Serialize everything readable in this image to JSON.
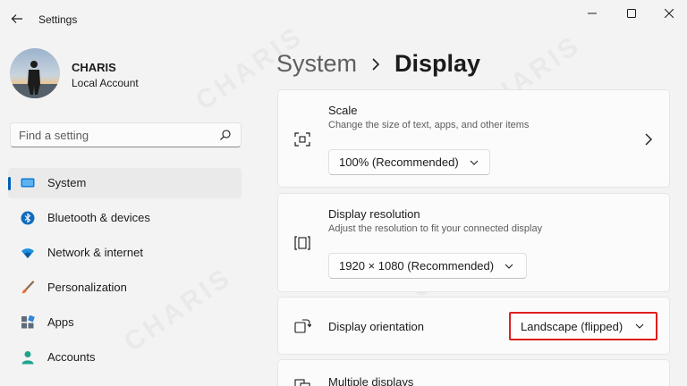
{
  "window": {
    "title": "Settings",
    "icons": {
      "back": "back-arrow-icon",
      "minimize": "minimize-icon",
      "maximize": "maximize-icon",
      "close": "close-icon"
    }
  },
  "profile": {
    "name": "CHARIS",
    "account_type": "Local Account"
  },
  "search": {
    "placeholder": "Find a setting"
  },
  "nav": {
    "items": [
      {
        "label": "System",
        "icon": "system-icon",
        "active": true
      },
      {
        "label": "Bluetooth & devices",
        "icon": "bluetooth-icon",
        "active": false
      },
      {
        "label": "Network & internet",
        "icon": "wifi-icon",
        "active": false
      },
      {
        "label": "Personalization",
        "icon": "brush-icon",
        "active": false
      },
      {
        "label": "Apps",
        "icon": "apps-icon",
        "active": false
      },
      {
        "label": "Accounts",
        "icon": "person-icon",
        "active": false
      }
    ]
  },
  "breadcrumb": {
    "parent": "System",
    "current": "Display"
  },
  "cards": {
    "scale": {
      "title": "Scale",
      "description": "Change the size of text, apps, and other items",
      "value": "100% (Recommended)"
    },
    "resolution": {
      "title": "Display resolution",
      "description": "Adjust the resolution to fit your connected display",
      "value": "1920 × 1080 (Recommended)"
    },
    "orientation": {
      "title": "Display orientation",
      "value": "Landscape (flipped)"
    },
    "multiple": {
      "title": "Multiple displays"
    }
  },
  "watermark": "CHARIS",
  "colors": {
    "accent": "#005fb8",
    "highlight": "#e01e1e"
  }
}
